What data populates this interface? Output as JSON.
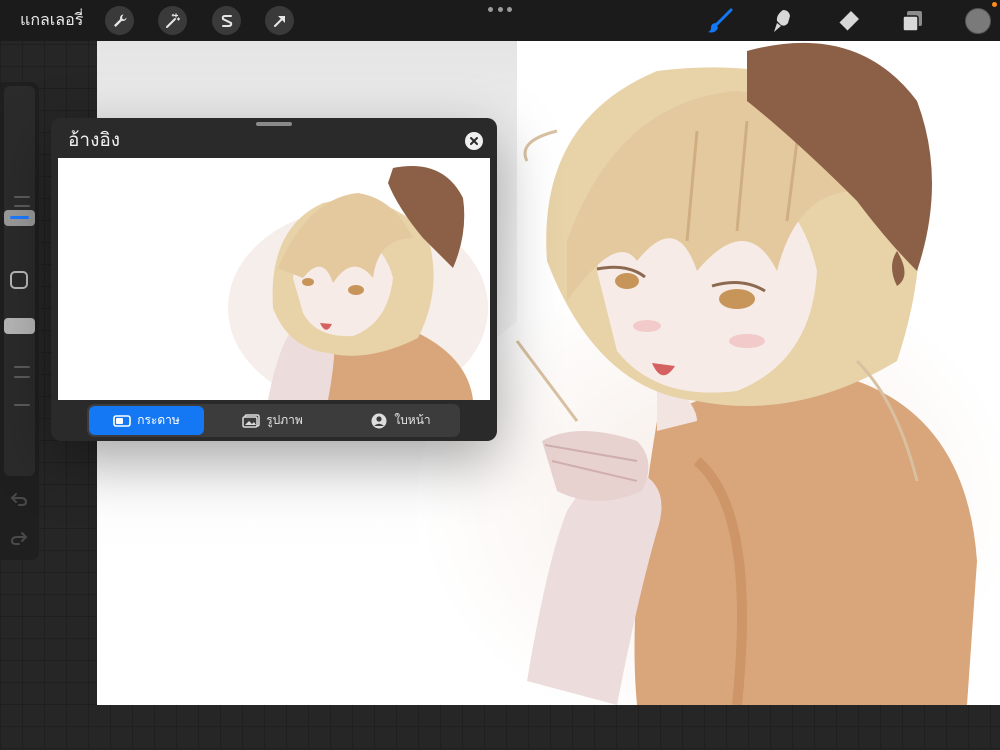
{
  "topbar": {
    "gallery_label": "แกลเลอรี่",
    "left_tools": [
      "wrench-icon",
      "magic-wand-icon",
      "selection-icon",
      "transform-arrow-icon"
    ],
    "right_tools": [
      "brush-icon",
      "smudge-icon",
      "eraser-icon",
      "layers-icon"
    ],
    "active_tool": "brush-icon",
    "accent_color": "#1478f5",
    "current_color": "#7a7a7a",
    "status_dot_color": "#ff8c1a"
  },
  "sidebar": {
    "controls": [
      "brush-size-slider",
      "modify-button",
      "opacity-slider",
      "undo-icon",
      "redo-icon"
    ]
  },
  "reference_panel": {
    "title": "อ้างอิง",
    "tabs": [
      {
        "label": "กระดาษ",
        "icon": "canvas-icon",
        "active": true
      },
      {
        "label": "รูปภาพ",
        "icon": "image-icon",
        "active": false
      },
      {
        "label": "ใบหน้า",
        "icon": "face-icon",
        "active": false
      }
    ]
  }
}
